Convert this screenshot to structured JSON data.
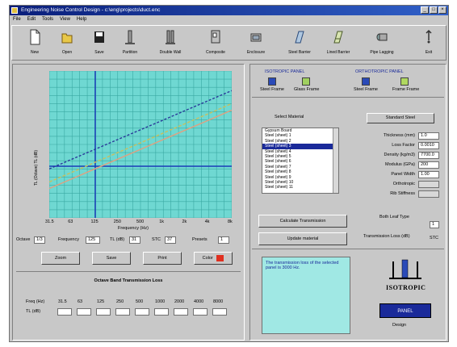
{
  "window": {
    "title": "Engineering Noise Control Design - c:\\eng\\projects\\duct.enc"
  },
  "menu": [
    "File",
    "Edit",
    "Tools",
    "View",
    "Help"
  ],
  "toolbar": [
    {
      "label": "New",
      "icon": "new-file-icon"
    },
    {
      "label": "Open",
      "icon": "open-folder-icon"
    },
    {
      "label": "Save",
      "icon": "save-disk-icon"
    },
    {
      "label": "Partition",
      "icon": "partition-icon"
    },
    {
      "label": "Double Wall",
      "icon": "double-wall-icon"
    },
    {
      "label": "Composite",
      "icon": "composite-icon"
    },
    {
      "label": "Enclosure",
      "icon": "enclosure-icon"
    },
    {
      "label": "Steel Barrier",
      "icon": "barrier-icon"
    },
    {
      "label": "Lined Barrier",
      "icon": "lined-barrier-icon"
    },
    {
      "label": "Pipe Lagging",
      "icon": "pipe-lagging-icon"
    },
    {
      "label": "Exit",
      "icon": "exit-icon"
    }
  ],
  "chart": {
    "ylabel": "TL (Octave) TL (dB)",
    "xlabel": "Frequency (Hz)",
    "ticks": [
      "31.5",
      "63",
      "125",
      "250",
      "500",
      "1k",
      "2k",
      "4k",
      "8k"
    ]
  },
  "chart_data": {
    "type": "line",
    "x": [
      "31.5",
      "63",
      "125",
      "250",
      "500",
      "1k",
      "2k",
      "4k",
      "8k"
    ],
    "series": [
      {
        "values": [
          30,
          36,
          42,
          48,
          54,
          60,
          66,
          72,
          78
        ],
        "color": "#2a3a9a",
        "dash": "3,2"
      },
      {
        "values": [
          22,
          28,
          34,
          40,
          46,
          52,
          58,
          64,
          70
        ],
        "color": "#c8c060",
        "dash": "4,2"
      },
      {
        "values": [
          18,
          24,
          30,
          36,
          42,
          48,
          54,
          60,
          66
        ],
        "color": "#e0a080",
        "dash": ""
      }
    ],
    "ylim": [
      0,
      90
    ]
  },
  "readouts": [
    {
      "label": "Octave",
      "value": "1/3"
    },
    {
      "label": "Frequency",
      "value": "125"
    },
    {
      "label": "TL (dB)",
      "value": "31"
    },
    {
      "label": "STC",
      "value": "37"
    },
    {
      "label": "Presets",
      "value": "1"
    }
  ],
  "actions": {
    "zoom": "Zoom",
    "save": "Save",
    "print": "Print",
    "color": "Color"
  },
  "octave_table": {
    "title": "Octave Band Transmission Loss",
    "freq_label": "Freq (Hz)",
    "tl_label": "TL (dB)",
    "freqs": [
      "31.5",
      "63",
      "125",
      "250",
      "500",
      "1000",
      "2000",
      "4000",
      "8000"
    ],
    "values": [
      "",
      "",
      "",
      "",
      "",
      "",
      "",
      "",
      ""
    ]
  },
  "right": {
    "legend_left_title": "ISOTROPIC PANEL",
    "legend_right_title": "ORTHOTROPIC PANEL",
    "legend": [
      {
        "label": "Steel Frame",
        "color": "#2a4ab8"
      },
      {
        "label": "Glass Frame",
        "color": "#a0d060"
      },
      {
        "label": "Steel Frame",
        "color": "#2a4ab8"
      },
      {
        "label": "Frame Frame",
        "color": "#b0d860"
      }
    ],
    "list_title": "Select Material",
    "materials": [
      "Gypsum Board",
      "Steel (sheet) 1",
      "Steel (sheet) 2",
      "Steel (sheet) 3",
      "Steel (sheet) 4",
      "Steel (sheet) 5",
      "Steel (sheet) 6",
      "Steel (sheet) 7",
      "Steel (sheet) 8",
      "Steel (sheet) 9",
      "Steel (sheet) 10",
      "Steel (sheet) 11"
    ],
    "selected_index": 3,
    "std_button": "Standard Steel",
    "props": [
      {
        "label": "Thickness (mm)",
        "value": "1.0"
      },
      {
        "label": "Loss Factor",
        "value": "0.0010"
      },
      {
        "label": "Density (kg/m3)",
        "value": "7700.0"
      },
      {
        "label": "Modulus (GPa)",
        "value": "200"
      },
      {
        "label": "Panel Width",
        "value": "1.00"
      },
      {
        "label": "Orthotropic",
        "value": ""
      },
      {
        "label": "Rib Stiffness",
        "value": ""
      }
    ],
    "btn_calc": "Calculate Transmission",
    "btn_update": "Update material",
    "both_label": "Both Leaf Type",
    "both_value": "1",
    "wall_label": "Transmission Loss (dB)",
    "wall_value": "STC",
    "note": "The transmission loss of the selected panel is 3000 Hz.",
    "logo_text": "ISOTROPIC",
    "logo_sub": "PANEL",
    "logo_caption": "Design"
  }
}
